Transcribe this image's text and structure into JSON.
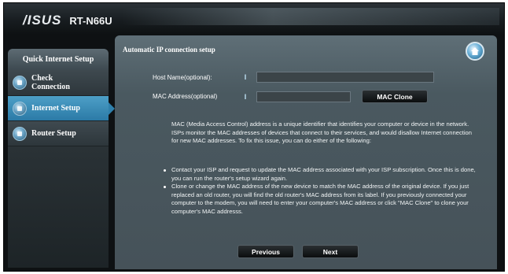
{
  "header": {
    "logo": "/ISUS",
    "model": "RT-N66U"
  },
  "sidebar": {
    "title": "Quick Internet Setup",
    "items": [
      {
        "label_line1": "Check",
        "label_line2": "Connection",
        "icon": "check-connection-icon"
      },
      {
        "label_line1": "Internet Setup",
        "label_line2": "",
        "icon": "internet-setup-icon"
      },
      {
        "label_line1": "Router Setup",
        "label_line2": "",
        "icon": "router-setup-icon"
      }
    ]
  },
  "panel": {
    "title": "Automatic IP connection setup",
    "home_icon": "home-icon",
    "fields": {
      "host_name": {
        "label": "Host Name(optional):",
        "value": ""
      },
      "mac_address": {
        "label": "MAC Address(optional)",
        "value": ""
      }
    },
    "mac_clone_label": "MAC Clone",
    "description": "MAC (Media Access Control) address is a unique identifier that identifies your computer or device in the network. ISPs monitor the MAC addresses of devices that connect to their services, and would disallow Internet connection for new MAC addresses. To fix this issue, you can do either of the following:",
    "bullets": [
      "Contact your ISP and request to update the MAC address associated with your ISP subscription. Once this is done, you can run the router's setup wizard again.",
      "Clone or change the MAC address of the new device to match the MAC address of the original device. If you just replaced an old router, you will find the old router's MAC address from its label. If you previously connected your computer to the modem, you will need to enter your computer's MAC address or click \"MAC Clone\" to clone your computer's MAC addresss."
    ],
    "previous_label": "Previous",
    "next_label": "Next"
  },
  "colors": {
    "accent": "#2f80ac",
    "panel": "#4a5960",
    "background": "#0e1113"
  }
}
